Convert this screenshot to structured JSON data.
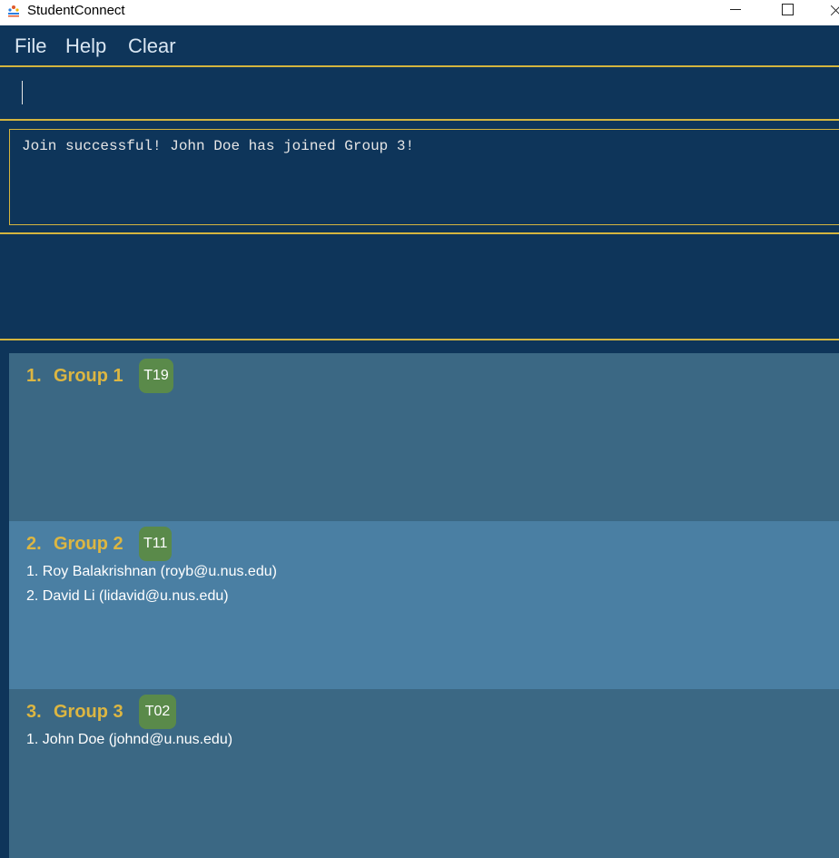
{
  "window": {
    "title": "StudentConnect",
    "icon": "app-logo-icon"
  },
  "menu": {
    "items": [
      {
        "label": "File"
      },
      {
        "label": "Help"
      },
      {
        "label": "Clear"
      }
    ]
  },
  "command": {
    "value": ""
  },
  "result": {
    "message": "Join successful! John Doe has joined Group 3!"
  },
  "groups": [
    {
      "index": "1.",
      "name": "Group 1",
      "tag": "T19",
      "members": []
    },
    {
      "index": "2.",
      "name": "Group 2",
      "tag": "T11",
      "members": [
        "1. Roy Balakrishnan (royb@u.nus.edu)",
        "2. David Li (lidavid@u.nus.edu)"
      ]
    },
    {
      "index": "3.",
      "name": "Group 3",
      "tag": "T02",
      "members": [
        "1. John Doe (johnd@u.nus.edu)"
      ]
    }
  ],
  "colors": {
    "background": "#0e355a",
    "accent": "#d4b53f",
    "group_title": "#dcb642",
    "tag": "#5a8a4a",
    "card_dark": "#3b6884",
    "card_light": "#4a7fa3"
  }
}
